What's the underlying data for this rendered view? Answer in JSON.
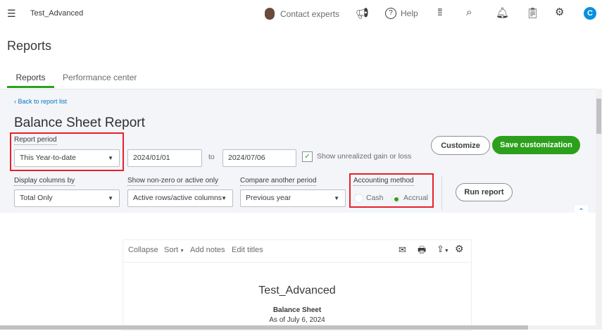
{
  "header": {
    "company": "Test_Advanced",
    "contact_experts": "Contact experts",
    "help": "Help",
    "avatar_letter": "C"
  },
  "page": {
    "title": "Reports",
    "tabs": [
      {
        "label": "Reports",
        "active": true
      },
      {
        "label": "Performance center",
        "active": false
      }
    ]
  },
  "report": {
    "back_link": "Back to report list",
    "title": "Balance Sheet Report",
    "report_period_label": "Report period",
    "report_period_value": "This Year-to-date",
    "date_from": "2024/01/01",
    "to_label": "to",
    "date_to": "2024/07/06",
    "unrealized_label": "Show unrealized gain or loss",
    "unrealized_checked": true,
    "customize": "Customize",
    "save_customization": "Save customization",
    "display_columns_label": "Display columns by",
    "display_columns_value": "Total Only",
    "nonzero_label": "Show non-zero or active only",
    "nonzero_value": "Active rows/active columns",
    "compare_label": "Compare another period",
    "compare_value": "Previous year",
    "accounting_label": "Accounting method",
    "cash": "Cash",
    "accrual": "Accrual",
    "selected_method": "Accrual",
    "run_report": "Run report"
  },
  "toolbar": {
    "collapse": "Collapse",
    "sort": "Sort",
    "add_notes": "Add notes",
    "edit_titles": "Edit titles"
  },
  "preview": {
    "company": "Test_Advanced",
    "title": "Balance Sheet",
    "as_of": "As of July 6, 2024"
  },
  "colors": {
    "accent": "#2ca01c",
    "highlight": "#e8202a",
    "link": "#0077c5"
  }
}
